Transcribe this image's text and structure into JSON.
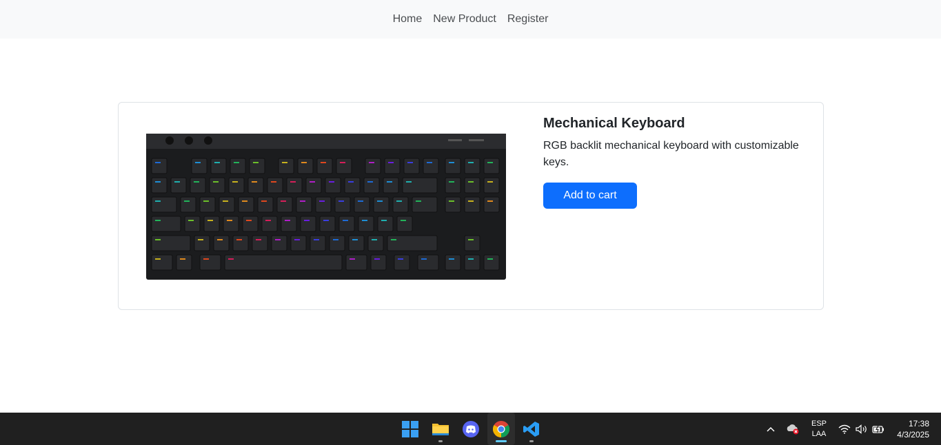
{
  "nav": {
    "links": [
      "Home",
      "New Product",
      "Register"
    ]
  },
  "product": {
    "title": "Mechanical Keyboard",
    "description": "RGB backlit mechanical keyboard with customizable keys.",
    "button_label": "Add to cart",
    "image_alt": "Mechanical keyboard with RGB backlight"
  },
  "taskbar": {
    "apps": [
      "windows-start",
      "file-explorer",
      "discord",
      "chrome",
      "vscode"
    ],
    "language_line1": "ESP",
    "language_line2": "LAA",
    "time": "17:38",
    "date": "4/3/2025"
  },
  "colors": {
    "primary": "#0d6efd",
    "navbar_bg": "#f8f9fa",
    "taskbar_bg": "#202020"
  }
}
